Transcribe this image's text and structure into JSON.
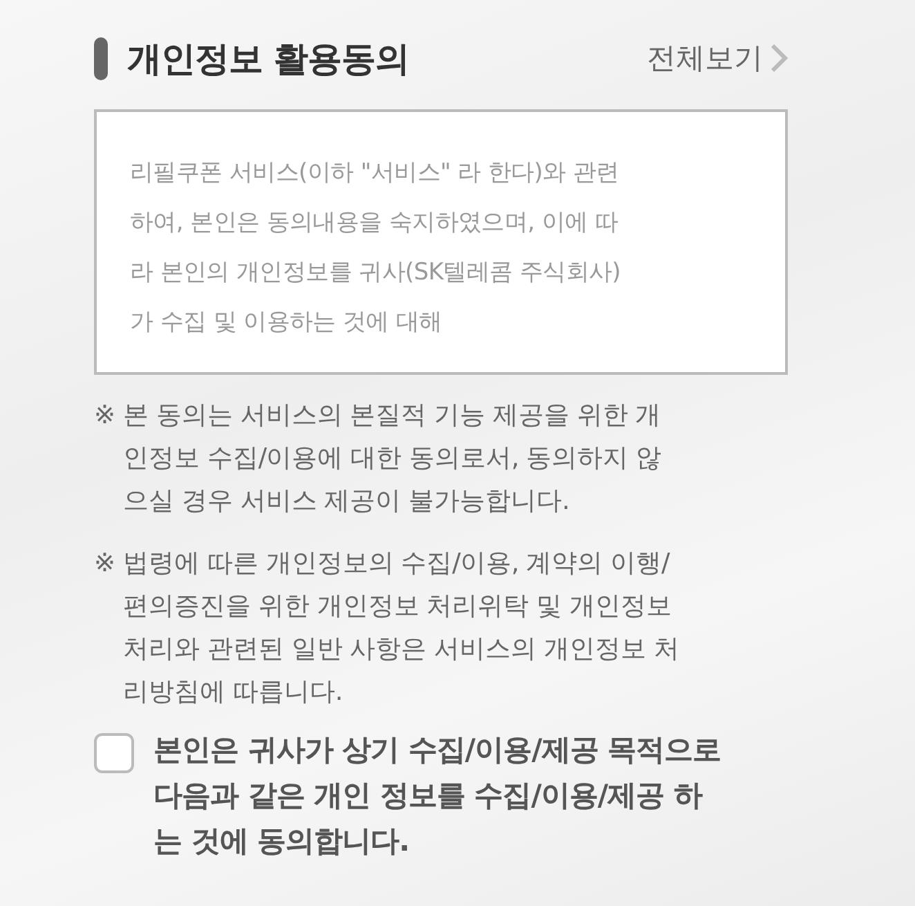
{
  "header": {
    "title": "개인정보 활용동의",
    "link": "전체보기"
  },
  "terms_box": {
    "lines": [
      "리필쿠폰 서비스(이하 \"서비스\" 라 한다)와 관련",
      "하여, 본인은 동의내용을 숙지하였으며, 이에 따",
      "라 본인의 개인정보를 귀사(SK텔레콤 주식회사)",
      "가 수집 및 이용하는 것에 대해"
    ]
  },
  "notes": [
    {
      "mark": "※",
      "lines": [
        "본 동의는 서비스의 본질적 기능 제공을 위한 개",
        "인정보 수집/이용에 대한 동의로서, 동의하지 않",
        "으실 경우 서비스 제공이 불가능합니다."
      ]
    },
    {
      "mark": "※",
      "lines": [
        "법령에 따른 개인정보의 수집/이용, 계약의 이행/",
        "편의증진을 위한 개인정보 처리위탁 및 개인정보",
        "처리와 관련된 일반 사항은 서비스의 개인정보 처",
        "리방침에 따릅니다."
      ]
    }
  ],
  "agreement": {
    "checked": false,
    "lines": [
      "본인은 귀사가 상기 수집/이용/제공 목적으로",
      "다음과 같은 개인 정보를 수집/이용/제공 하",
      "는 것에 동의합니다."
    ]
  }
}
